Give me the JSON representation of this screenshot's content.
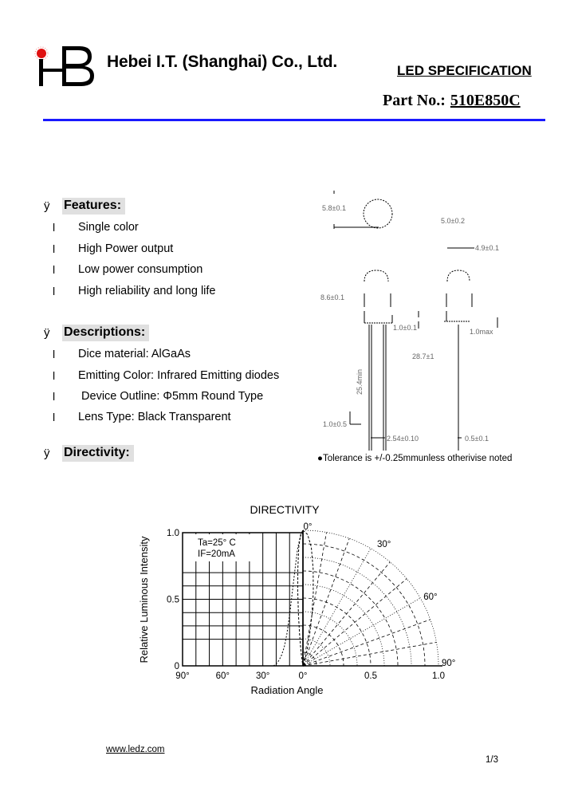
{
  "header": {
    "logo_letters": "HB",
    "company_name": "Hebei I.T. (Shanghai) Co., Ltd.",
    "doc_title": "LED SPECIFICATION",
    "part_label": "Part No.:",
    "part_number": "510E850C",
    "accent_color": "#1a1aff",
    "logo_dot_color": "#e01010"
  },
  "sections": {
    "bullet_glyph": "ÿ",
    "item_glyph": "l",
    "features": {
      "title": "Features:",
      "items": [
        "Single color",
        "High Power output",
        "Low power consumption",
        "High reliability and long life"
      ]
    },
    "descriptions": {
      "title": "Descriptions:",
      "items": [
        "Dice material: AlGaAs",
        "Emitting Color: Infrared Emitting diodes",
        " Device Outline: Φ5mm Round Type",
        "Lens Type: Black Transparent"
      ]
    },
    "directivity": {
      "title": "Directivity:"
    }
  },
  "drawing": {
    "dims": {
      "lens_dia": "5.8±0.1",
      "top_width": "5.0±0.2",
      "body_width": "4.9±0.1",
      "body_height": "8.6±0.1",
      "flange": "1.0±0.1",
      "flange_max": "1.0max",
      "lead_length_short": "25.4min",
      "lead_length": "28.7±1",
      "lead_spacing": "2.54±0.10",
      "lead_offset": "1.0±0.5",
      "lead_width": "0.5±0.1"
    },
    "tolerance_note": "●Tolerance is +/-0.25mmunless otherivise noted"
  },
  "chart_data": {
    "type": "line",
    "title": "DIRECTIVITY",
    "xlabel": "Radiation Angle",
    "ylabel": "Relative Luminous Intensity",
    "conditions": [
      "Ta=25° C",
      "IF=20mA"
    ],
    "cartesian": {
      "x_tick_labels": [
        "90°",
        "60°",
        "30°",
        "0°"
      ],
      "y_tick_labels": [
        "1.0",
        "0.5",
        "0"
      ],
      "xlim_deg": [
        90,
        0
      ],
      "ylim": [
        0,
        1.0
      ],
      "series": [
        {
          "name": "relative-intensity",
          "angle_deg": [
            0,
            2,
            4,
            6,
            8,
            10,
            12,
            14,
            16,
            18,
            20,
            22
          ],
          "values": [
            1.0,
            0.97,
            0.88,
            0.72,
            0.55,
            0.38,
            0.24,
            0.14,
            0.08,
            0.04,
            0.015,
            0.0
          ]
        }
      ]
    },
    "polar": {
      "angle_labels": [
        "0°",
        "30°",
        "60°",
        "90°"
      ],
      "radial_tick_labels": [
        "0°",
        "0.5",
        "1.0"
      ],
      "rlim": [
        0,
        1.0
      ]
    },
    "grid": true
  },
  "footer": {
    "website": "www.ledz.com",
    "page": "1/3"
  }
}
